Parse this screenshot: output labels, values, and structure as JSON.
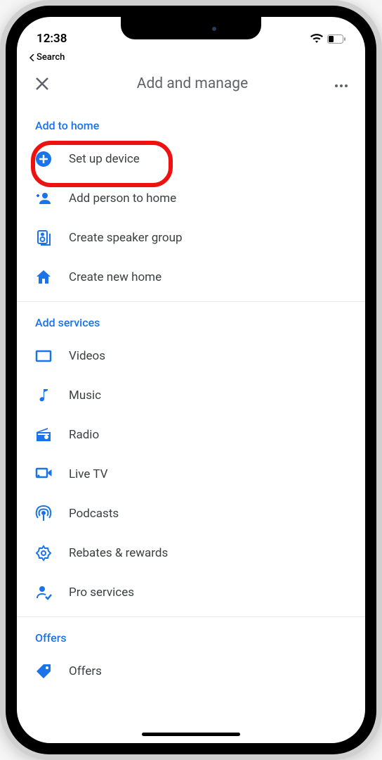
{
  "status": {
    "time": "12:38",
    "back_label": "Search"
  },
  "header": {
    "title": "Add and manage"
  },
  "sections": {
    "add_to_home": {
      "title": "Add to home",
      "items": [
        {
          "label": "Set up device",
          "icon": "plus-circle",
          "highlighted": true
        },
        {
          "label": "Add person to home",
          "icon": "person-add"
        },
        {
          "label": "Create speaker group",
          "icon": "speaker"
        },
        {
          "label": "Create new home",
          "icon": "home"
        }
      ]
    },
    "add_services": {
      "title": "Add services",
      "items": [
        {
          "label": "Videos",
          "icon": "video"
        },
        {
          "label": "Music",
          "icon": "music"
        },
        {
          "label": "Radio",
          "icon": "radio"
        },
        {
          "label": "Live TV",
          "icon": "live-tv"
        },
        {
          "label": "Podcasts",
          "icon": "podcasts"
        },
        {
          "label": "Rebates & rewards",
          "icon": "rewards"
        },
        {
          "label": "Pro services",
          "icon": "pro-services"
        }
      ]
    },
    "offers": {
      "title": "Offers",
      "items": [
        {
          "label": "Offers",
          "icon": "tag"
        }
      ]
    }
  }
}
